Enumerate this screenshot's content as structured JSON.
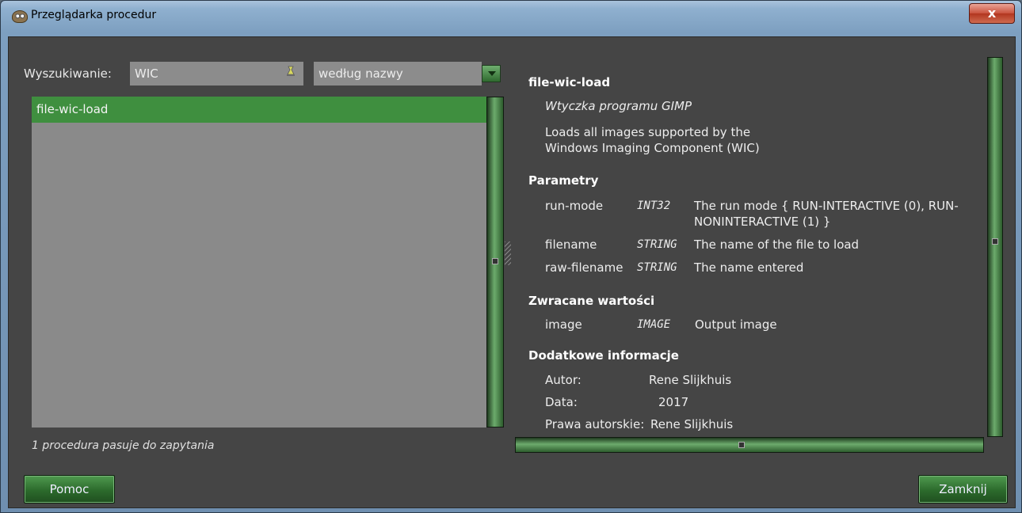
{
  "window": {
    "title": "Przeglądarka procedur",
    "close_label": "x"
  },
  "search": {
    "label": "Wyszukiwanie:",
    "value": "WIC",
    "mode": "według nazwy"
  },
  "list": {
    "items": [
      "file-wic-load"
    ],
    "selected": "file-wic-load"
  },
  "status": "1 procedura pasuje do zapytania",
  "detail": {
    "name": "file-wic-load",
    "plugin": "Wtyczka programu GIMP",
    "blurb_line1": "Loads all images supported by the",
    "blurb_line2": "Windows Imaging Component (WIC)",
    "params_heading": "Parametry",
    "params": [
      {
        "name": "run-mode",
        "type": "INT32",
        "desc1": "The run mode { RUN-INTERACTIVE (0), RUN-",
        "desc2": "NONINTERACTIVE (1) }"
      },
      {
        "name": "filename",
        "type": "STRING",
        "desc1": "The name of the file to load"
      },
      {
        "name": "raw-filename",
        "type": "STRING",
        "desc1": "The name entered"
      }
    ],
    "returns_heading": "Zwracane wartości",
    "returns": [
      {
        "name": "image",
        "type": "IMAGE",
        "desc": "Output image"
      }
    ],
    "extra_heading": "Dodatkowe informacje",
    "author_label": "Autor:",
    "author": "Rene Slijkhuis",
    "date_label": "Data:",
    "date": "2017",
    "copyright_label": "Prawa autorskie:",
    "copyright": "Rene Slijkhuis"
  },
  "buttons": {
    "help": "Pomoc",
    "close": "Zamknij"
  }
}
